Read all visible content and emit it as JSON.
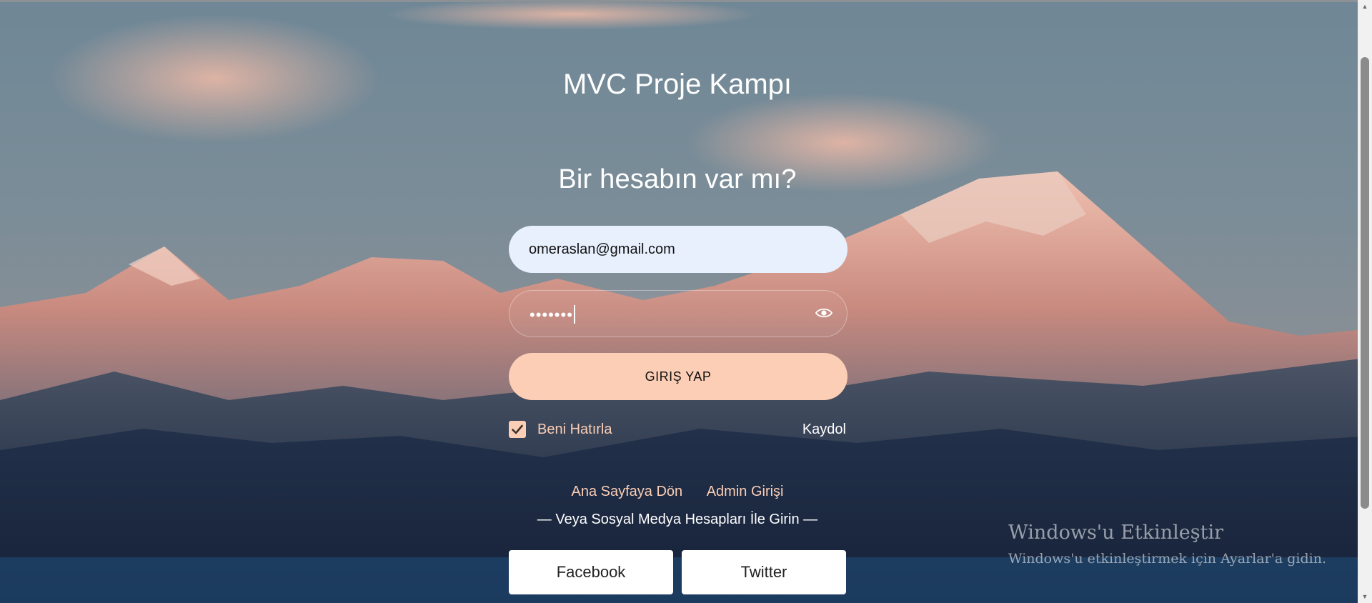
{
  "page": {
    "title": "MVC Proje Kampı",
    "subtitle": "Bir hesabın var mı?"
  },
  "form": {
    "email_value": "omeraslan@gmail.com",
    "password_mask": "•••••••",
    "login_label": "GIRIŞ YAP",
    "remember_label": "Beni Hatırla",
    "remember_checked": true,
    "register_label": "Kaydol"
  },
  "links": {
    "home_label": "Ana Sayfaya Dön",
    "admin_label": "Admin Girişi",
    "social_divider": "— Veya Sosyal Medya Hesapları İle Girin —"
  },
  "social": {
    "facebook_label": "Facebook",
    "twitter_label": "Twitter"
  },
  "watermark": {
    "title": "Windows'u Etkinleştir",
    "subtitle": "Windows'u etkinleştirmek için Ayarlar'a gidin."
  },
  "colors": {
    "accent": "#fbceb5",
    "email_bg": "#e8f0fe"
  },
  "icons": {
    "password_toggle": "eye-icon",
    "checkbox": "check-icon"
  }
}
